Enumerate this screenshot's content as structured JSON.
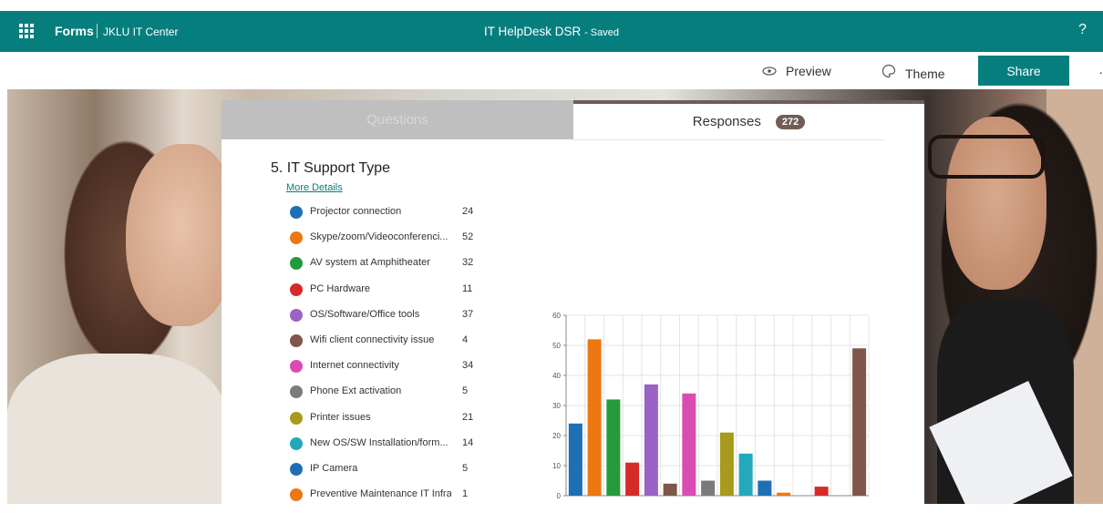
{
  "topbar": {
    "app_name": "Forms",
    "org": "JKLU IT Center",
    "doc_title": "IT HelpDesk DSR",
    "save_status": "- Saved",
    "help": "?"
  },
  "commandbar": {
    "preview": "Preview",
    "theme": "Theme",
    "share": "Share",
    "more": "·"
  },
  "tabs": {
    "questions": "Questions",
    "responses": "Responses",
    "responses_count": "272"
  },
  "question": {
    "title": "5. IT Support Type",
    "more_details": "More Details"
  },
  "legend": [
    {
      "label": "Projector connection",
      "value": "24",
      "color": "#1f6fb5"
    },
    {
      "label": "Skype/zoom/Videoconferenci...",
      "value": "52",
      "color": "#ed7711"
    },
    {
      "label": "AV system at Amphitheater",
      "value": "32",
      "color": "#259a3a"
    },
    {
      "label": "PC Hardware",
      "value": "11",
      "color": "#d62a2a"
    },
    {
      "label": "OS/Software/Office tools",
      "value": "37",
      "color": "#9a62c4"
    },
    {
      "label": "Wifi client connectivity issue",
      "value": "4",
      "color": "#7e564a"
    },
    {
      "label": "Internet connectivity",
      "value": "34",
      "color": "#da4cb2"
    },
    {
      "label": "Phone Ext activation",
      "value": "5",
      "color": "#7a7a7a"
    },
    {
      "label": "Printer issues",
      "value": "21",
      "color": "#a89a1d"
    },
    {
      "label": "New OS/SW Installation/form...",
      "value": "14",
      "color": "#23a9bb"
    },
    {
      "label": "IP Camera",
      "value": "5",
      "color": "#1f6fb5"
    },
    {
      "label": "Preventive Maintenance IT Infra",
      "value": "1",
      "color": "#ed7711"
    }
  ],
  "chart_data": {
    "type": "bar",
    "categories": [
      "Projector connection",
      "Skype/zoom/Videoconferenci...",
      "AV system at Amphitheater",
      "PC Hardware",
      "OS/Software/Office tools",
      "Wifi client connectivity issue",
      "Internet connectivity",
      "Phone Ext activation",
      "Printer issues",
      "New OS/SW Installation/form...",
      "IP Camera",
      "Preventive Maintenance IT Infra",
      "",
      "",
      "",
      ""
    ],
    "values": [
      24,
      52,
      32,
      11,
      37,
      4,
      34,
      5,
      21,
      14,
      5,
      1,
      0,
      3,
      0,
      49
    ],
    "colors": [
      "#1f6fb5",
      "#ed7711",
      "#259a3a",
      "#d62a2a",
      "#9a62c4",
      "#7e564a",
      "#da4cb2",
      "#7a7a7a",
      "#a89a1d",
      "#23a9bb",
      "#1f6fb5",
      "#ed7711",
      "#259a3a",
      "#d62a2a",
      "#9a62c4",
      "#7e564a"
    ],
    "yticks": [
      "0",
      "10",
      "20",
      "30",
      "40",
      "50",
      "60"
    ],
    "ylim": [
      0,
      60
    ],
    "grid": true,
    "title": "",
    "xlabel": "",
    "ylabel": ""
  }
}
